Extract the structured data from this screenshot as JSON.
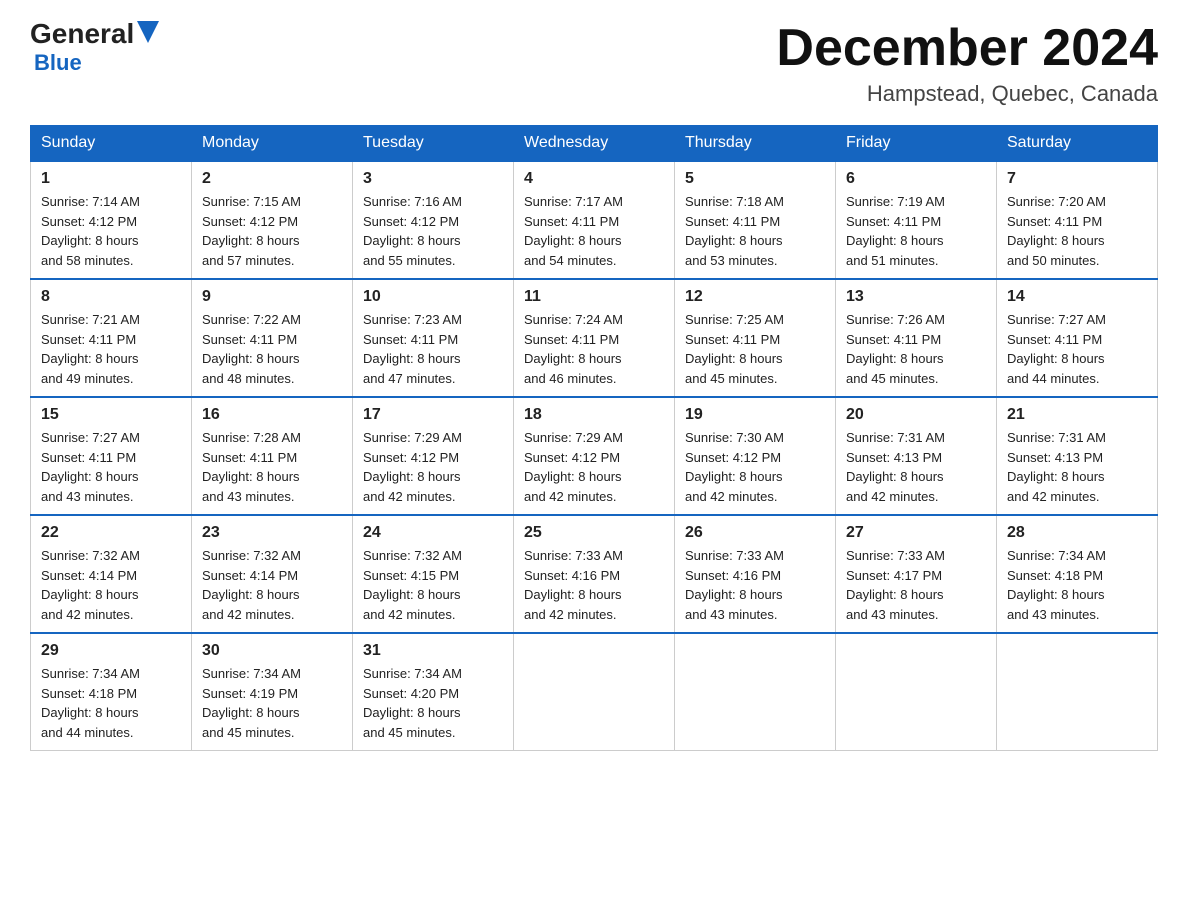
{
  "header": {
    "logo_general": "General",
    "logo_blue": "Blue",
    "title": "December 2024",
    "subtitle": "Hampstead, Quebec, Canada"
  },
  "days_of_week": [
    "Sunday",
    "Monday",
    "Tuesday",
    "Wednesday",
    "Thursday",
    "Friday",
    "Saturday"
  ],
  "weeks": [
    [
      {
        "day": "1",
        "sunrise": "7:14 AM",
        "sunset": "4:12 PM",
        "daylight": "8 hours and 58 minutes."
      },
      {
        "day": "2",
        "sunrise": "7:15 AM",
        "sunset": "4:12 PM",
        "daylight": "8 hours and 57 minutes."
      },
      {
        "day": "3",
        "sunrise": "7:16 AM",
        "sunset": "4:12 PM",
        "daylight": "8 hours and 55 minutes."
      },
      {
        "day": "4",
        "sunrise": "7:17 AM",
        "sunset": "4:11 PM",
        "daylight": "8 hours and 54 minutes."
      },
      {
        "day": "5",
        "sunrise": "7:18 AM",
        "sunset": "4:11 PM",
        "daylight": "8 hours and 53 minutes."
      },
      {
        "day": "6",
        "sunrise": "7:19 AM",
        "sunset": "4:11 PM",
        "daylight": "8 hours and 51 minutes."
      },
      {
        "day": "7",
        "sunrise": "7:20 AM",
        "sunset": "4:11 PM",
        "daylight": "8 hours and 50 minutes."
      }
    ],
    [
      {
        "day": "8",
        "sunrise": "7:21 AM",
        "sunset": "4:11 PM",
        "daylight": "8 hours and 49 minutes."
      },
      {
        "day": "9",
        "sunrise": "7:22 AM",
        "sunset": "4:11 PM",
        "daylight": "8 hours and 48 minutes."
      },
      {
        "day": "10",
        "sunrise": "7:23 AM",
        "sunset": "4:11 PM",
        "daylight": "8 hours and 47 minutes."
      },
      {
        "day": "11",
        "sunrise": "7:24 AM",
        "sunset": "4:11 PM",
        "daylight": "8 hours and 46 minutes."
      },
      {
        "day": "12",
        "sunrise": "7:25 AM",
        "sunset": "4:11 PM",
        "daylight": "8 hours and 45 minutes."
      },
      {
        "day": "13",
        "sunrise": "7:26 AM",
        "sunset": "4:11 PM",
        "daylight": "8 hours and 45 minutes."
      },
      {
        "day": "14",
        "sunrise": "7:27 AM",
        "sunset": "4:11 PM",
        "daylight": "8 hours and 44 minutes."
      }
    ],
    [
      {
        "day": "15",
        "sunrise": "7:27 AM",
        "sunset": "4:11 PM",
        "daylight": "8 hours and 43 minutes."
      },
      {
        "day": "16",
        "sunrise": "7:28 AM",
        "sunset": "4:11 PM",
        "daylight": "8 hours and 43 minutes."
      },
      {
        "day": "17",
        "sunrise": "7:29 AM",
        "sunset": "4:12 PM",
        "daylight": "8 hours and 42 minutes."
      },
      {
        "day": "18",
        "sunrise": "7:29 AM",
        "sunset": "4:12 PM",
        "daylight": "8 hours and 42 minutes."
      },
      {
        "day": "19",
        "sunrise": "7:30 AM",
        "sunset": "4:12 PM",
        "daylight": "8 hours and 42 minutes."
      },
      {
        "day": "20",
        "sunrise": "7:31 AM",
        "sunset": "4:13 PM",
        "daylight": "8 hours and 42 minutes."
      },
      {
        "day": "21",
        "sunrise": "7:31 AM",
        "sunset": "4:13 PM",
        "daylight": "8 hours and 42 minutes."
      }
    ],
    [
      {
        "day": "22",
        "sunrise": "7:32 AM",
        "sunset": "4:14 PM",
        "daylight": "8 hours and 42 minutes."
      },
      {
        "day": "23",
        "sunrise": "7:32 AM",
        "sunset": "4:14 PM",
        "daylight": "8 hours and 42 minutes."
      },
      {
        "day": "24",
        "sunrise": "7:32 AM",
        "sunset": "4:15 PM",
        "daylight": "8 hours and 42 minutes."
      },
      {
        "day": "25",
        "sunrise": "7:33 AM",
        "sunset": "4:16 PM",
        "daylight": "8 hours and 42 minutes."
      },
      {
        "day": "26",
        "sunrise": "7:33 AM",
        "sunset": "4:16 PM",
        "daylight": "8 hours and 43 minutes."
      },
      {
        "day": "27",
        "sunrise": "7:33 AM",
        "sunset": "4:17 PM",
        "daylight": "8 hours and 43 minutes."
      },
      {
        "day": "28",
        "sunrise": "7:34 AM",
        "sunset": "4:18 PM",
        "daylight": "8 hours and 43 minutes."
      }
    ],
    [
      {
        "day": "29",
        "sunrise": "7:34 AM",
        "sunset": "4:18 PM",
        "daylight": "8 hours and 44 minutes."
      },
      {
        "day": "30",
        "sunrise": "7:34 AM",
        "sunset": "4:19 PM",
        "daylight": "8 hours and 45 minutes."
      },
      {
        "day": "31",
        "sunrise": "7:34 AM",
        "sunset": "4:20 PM",
        "daylight": "8 hours and 45 minutes."
      },
      null,
      null,
      null,
      null
    ]
  ],
  "labels": {
    "sunrise": "Sunrise:",
    "sunset": "Sunset:",
    "daylight": "Daylight:"
  }
}
